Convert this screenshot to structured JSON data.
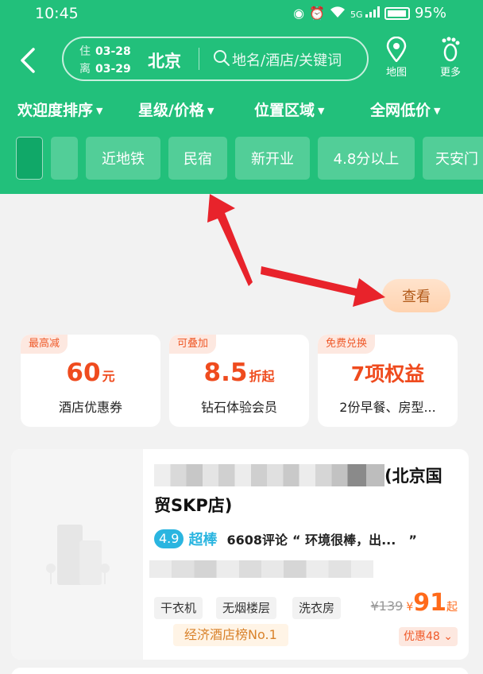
{
  "status_bar": {
    "time": "10:45",
    "signal": "5G",
    "battery": "95%"
  },
  "search": {
    "checkin_label": "住",
    "checkin_date": "03-28",
    "checkout_label": "离",
    "checkout_date": "03-29",
    "city": "北京",
    "placeholder": "地名/酒店/关键词"
  },
  "top_buttons": {
    "map": "地图",
    "more": "更多"
  },
  "filters": [
    "欢迎度排序",
    "星级/价格",
    "位置区域",
    "全网低价"
  ],
  "quick_tags": [
    "近地铁",
    "民宿",
    "新开业",
    "4.8分以上",
    "天安门"
  ],
  "view_button": "查看",
  "benefits": [
    {
      "badge": "最高减",
      "value": "60",
      "unit": "元",
      "desc": "酒店优惠券"
    },
    {
      "badge": "可叠加",
      "value": "8.5",
      "unit": "折起",
      "desc": "钻石体验会员"
    },
    {
      "badge": "免费兑换",
      "value": "7项权益",
      "unit": "",
      "desc": "2份早餐、房型..."
    }
  ],
  "hotel": {
    "name_suffix": "(北京国贸SKP店)",
    "score": "4.9",
    "score_label": "超棒",
    "reviews": "6608评论",
    "quote": "“ 环境很棒，出...　”",
    "amenities": [
      "干衣机",
      "无烟楼层",
      "洗衣房"
    ],
    "rank": "经济酒店榜No.1",
    "old_price": "¥139",
    "currency": "¥",
    "price": "91",
    "price_suffix": "起",
    "promo": "优惠48"
  },
  "colors": {
    "header_green": "#22c07b",
    "price_orange": "#ff6a1a",
    "arrow_red": "#e8232b"
  }
}
